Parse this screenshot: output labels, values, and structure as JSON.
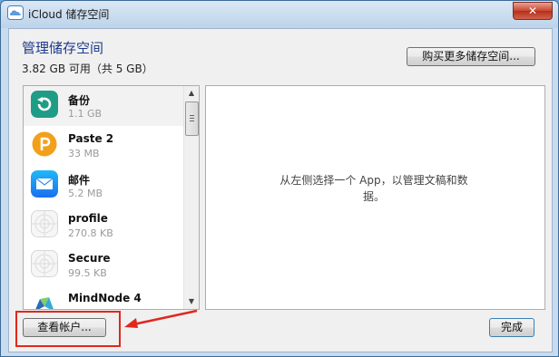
{
  "window": {
    "title": "iCloud 储存空间",
    "close_label": "✕"
  },
  "header": {
    "heading": "管理储存空间",
    "usage": "3.82 GB 可用（共 5 GB）",
    "buy_button": "购买更多储存空间..."
  },
  "apps": [
    {
      "name": "备份",
      "size": "1.1 GB",
      "icon": "backup-icon",
      "color": "#1e9c86"
    },
    {
      "name": "Paste 2",
      "size": "33 MB",
      "icon": "paste-icon",
      "color": "#f2a01a"
    },
    {
      "name": "邮件",
      "size": "5.2 MB",
      "icon": "mail-icon",
      "color": "#1f8cf0"
    },
    {
      "name": "profile",
      "size": "270.8 KB",
      "icon": "placeholder-app-icon",
      "color": "#e6e6e6"
    },
    {
      "name": "Secure",
      "size": "99.5 KB",
      "icon": "placeholder-app-icon",
      "color": "#e6e6e6"
    },
    {
      "name": "MindNode 4",
      "size": "",
      "icon": "mindnode-icon",
      "color": "#2d6bb5"
    }
  ],
  "detail": {
    "hint": "从左侧选择一个 App，以管理文稿和数据。"
  },
  "footer": {
    "account_button": "查看帐户...",
    "done_button": "完成"
  },
  "annotation_color": "#e0281e"
}
